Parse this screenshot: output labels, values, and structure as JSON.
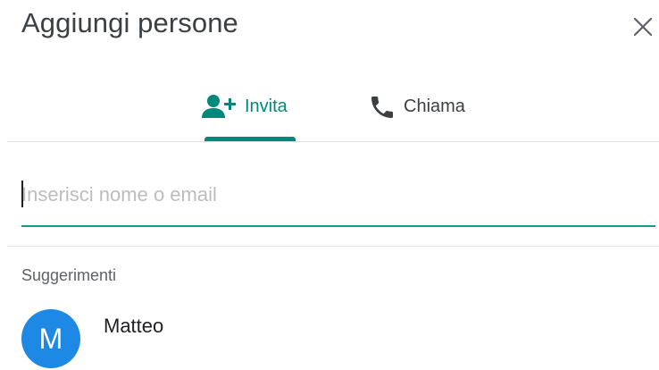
{
  "dialog": {
    "title": "Aggiungi persone"
  },
  "tabs": [
    {
      "label": "Invita",
      "icon": "person-add-icon",
      "selected": true
    },
    {
      "label": "Chiama",
      "icon": "phone-icon",
      "selected": false
    }
  ],
  "search": {
    "value": "",
    "placeholder": "Inserisci nome o email"
  },
  "suggestions": {
    "label": "Suggerimenti",
    "items": [
      {
        "name": "Matteo",
        "initial": "M"
      }
    ]
  },
  "colors": {
    "accent": "#00897b",
    "underline": "#129e8e",
    "avatar": "#1e88e5"
  }
}
